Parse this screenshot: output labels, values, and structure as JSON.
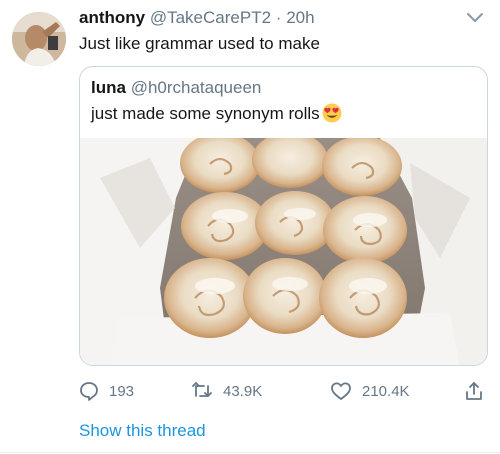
{
  "tweet": {
    "display_name": "anthony",
    "handle": "@TakeCarePT2",
    "separator": "·",
    "time": "20h",
    "text": "Just like grammar used to make"
  },
  "quoted_tweet": {
    "display_name": "luna",
    "handle": "@h0rchataqueen",
    "text": "just made some synonym rolls",
    "emoji": "heart-eyes-emoji",
    "photo": "cinnamon-rolls-in-baking-pan"
  },
  "actions": {
    "replies": "193",
    "retweets": "43.9K",
    "likes": "210.4K"
  },
  "show_thread_label": "Show this thread",
  "colors": {
    "text": "#14171a",
    "secondary": "#657786",
    "link": "#1b95e0",
    "border": "#ccd6dd"
  }
}
